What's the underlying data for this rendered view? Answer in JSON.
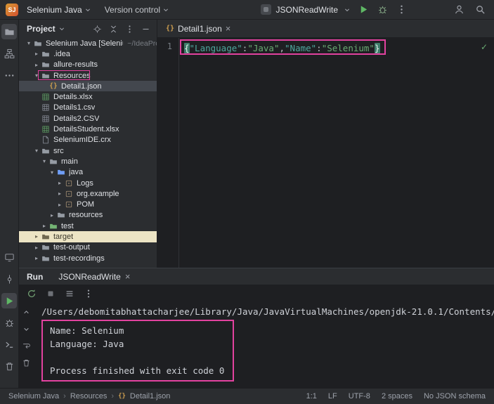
{
  "titlebar": {
    "project_badge": "SJ",
    "project_menu": "Selenium Java",
    "vcs_menu": "Version control",
    "run_config": "JSONReadWrite"
  },
  "toolstrip": {
    "top": [
      {
        "name": "project-tool-icon",
        "glyph": "folder",
        "active": true
      },
      {
        "name": "structure-tool-icon",
        "glyph": "structure"
      },
      {
        "name": "more-tool-windows-icon",
        "glyph": "more"
      }
    ],
    "bottom": [
      {
        "name": "services-tool-icon",
        "glyph": "monitor"
      },
      {
        "name": "vcs-tool-icon",
        "glyph": "vcs"
      },
      {
        "name": "run-tool-icon",
        "glyph": "play",
        "active": true,
        "color": "#5fb865"
      },
      {
        "name": "debug-tool-icon",
        "glyph": "bug"
      },
      {
        "name": "terminal-tool-icon",
        "glyph": "terminal"
      },
      {
        "name": "delete-icon",
        "glyph": "trash"
      }
    ]
  },
  "project_panel": {
    "title": "Project",
    "header_icons": [
      {
        "name": "locate-file-icon",
        "glyph": "locate"
      },
      {
        "name": "collapse-all-icon",
        "glyph": "collapse"
      },
      {
        "name": "panel-options-icon",
        "glyph": "kebab"
      },
      {
        "name": "hide-panel-icon",
        "glyph": "minimize"
      }
    ],
    "tree": [
      {
        "label": "Selenium Java [SeleniumJava]",
        "suffix": "~/IdeaProj...",
        "level": 0,
        "arrow": "open",
        "icon": "folder"
      },
      {
        "label": ".idea",
        "level": 1,
        "arrow": "closed",
        "icon": "folder"
      },
      {
        "label": "allure-results",
        "level": 1,
        "arrow": "closed",
        "icon": "folder"
      },
      {
        "label": "Resources",
        "level": 1,
        "arrow": "open",
        "icon": "folder",
        "annotated": true
      },
      {
        "label": "Detail1.json",
        "level": 2,
        "arrow": "none",
        "icon": "json",
        "state": "selected"
      },
      {
        "label": "Details.xlsx",
        "level": 1,
        "arrow": "none",
        "icon": "xlsx"
      },
      {
        "label": "Details1.csv",
        "level": 1,
        "arrow": "none",
        "icon": "csv"
      },
      {
        "label": "Details2.CSV",
        "level": 1,
        "arrow": "none",
        "icon": "csv"
      },
      {
        "label": "DetailsStudent.xlsx",
        "level": 1,
        "arrow": "none",
        "icon": "xlsx"
      },
      {
        "label": "SeleniumIDE.crx",
        "level": 1,
        "arrow": "none",
        "icon": "crx"
      },
      {
        "label": "src",
        "level": 1,
        "arrow": "open",
        "icon": "folder"
      },
      {
        "label": "main",
        "level": 2,
        "arrow": "open",
        "icon": "folder"
      },
      {
        "label": "java",
        "level": 3,
        "arrow": "open",
        "icon": "folder-blue"
      },
      {
        "label": "Logs",
        "level": 4,
        "arrow": "closed",
        "icon": "package"
      },
      {
        "label": "org.example",
        "level": 4,
        "arrow": "closed",
        "icon": "package"
      },
      {
        "label": "POM",
        "level": 4,
        "arrow": "closed",
        "icon": "package"
      },
      {
        "label": "resources",
        "level": 3,
        "arrow": "closed",
        "icon": "folder"
      },
      {
        "label": "test",
        "level": 2,
        "arrow": "closed",
        "icon": "folder-green"
      },
      {
        "label": "target",
        "level": 1,
        "arrow": "closed",
        "icon": "folder",
        "state": "excluded"
      },
      {
        "label": "test-output",
        "level": 1,
        "arrow": "closed",
        "icon": "folder"
      },
      {
        "label": "test-recordings",
        "level": 1,
        "arrow": "closed",
        "icon": "folder"
      }
    ]
  },
  "editor": {
    "tab_label": "Detail1.json",
    "line_number": "1",
    "code_text": "{\"Language\":\"Java\",\"Name\":\"Selenium\"}",
    "tokens": [
      {
        "text": "{",
        "type": "brace-hl"
      },
      {
        "text": "\"Language\"",
        "type": "key"
      },
      {
        "text": ":",
        "type": "punct"
      },
      {
        "text": "\"Java\"",
        "type": "string"
      },
      {
        "text": ",",
        "type": "punct"
      },
      {
        "text": "\"Name\"",
        "type": "key"
      },
      {
        "text": ":",
        "type": "punct"
      },
      {
        "text": "\"Selenium\"",
        "type": "string"
      },
      {
        "text": "}",
        "type": "brace-hl"
      }
    ],
    "inspection_status": "✓"
  },
  "run_panel": {
    "title": "Run",
    "tab_label": "JSONReadWrite",
    "toolbar_icons": [
      {
        "name": "rerun-icon",
        "glyph": "rerun",
        "color": "#77a877"
      },
      {
        "name": "stop-icon",
        "glyph": "stop",
        "color": "#6e7177"
      },
      {
        "name": "view-options-icon",
        "glyph": "menu"
      },
      {
        "name": "more-options-icon",
        "glyph": "kebab"
      }
    ],
    "gutter_icons": [
      {
        "name": "scroll-up-icon",
        "glyph": "up"
      },
      {
        "name": "scroll-down-icon",
        "glyph": "chevron"
      },
      {
        "name": "soft-wrap-icon",
        "glyph": "softwrap"
      },
      {
        "name": "clear-console-icon",
        "glyph": "trash"
      }
    ],
    "command_line": "/Users/debomitabhattacharjee/Library/Java/JavaVirtualMachines/openjdk-21.0.1/Contents/Home/bi",
    "output_lines": [
      "Name: Selenium",
      "Language: Java",
      "",
      "Process finished with exit code 0"
    ]
  },
  "statusbar": {
    "breadcrumbs": [
      {
        "name": "breadcrumb-project",
        "label": "Selenium Java"
      },
      {
        "name": "breadcrumb-folder",
        "label": "Resources"
      },
      {
        "name": "breadcrumb-file",
        "label": "Detail1.json",
        "icon": "json"
      }
    ],
    "right_items": [
      {
        "name": "caret-position",
        "label": "1:1"
      },
      {
        "name": "line-ending",
        "label": "LF"
      },
      {
        "name": "file-encoding",
        "label": "UTF-8"
      },
      {
        "name": "indent-size",
        "label": "2 spaces"
      },
      {
        "name": "json-schema-status",
        "label": "No JSON schema"
      }
    ]
  },
  "colors": {
    "annotation_pink": "#e2429f",
    "accent_green": "#5fb865"
  }
}
